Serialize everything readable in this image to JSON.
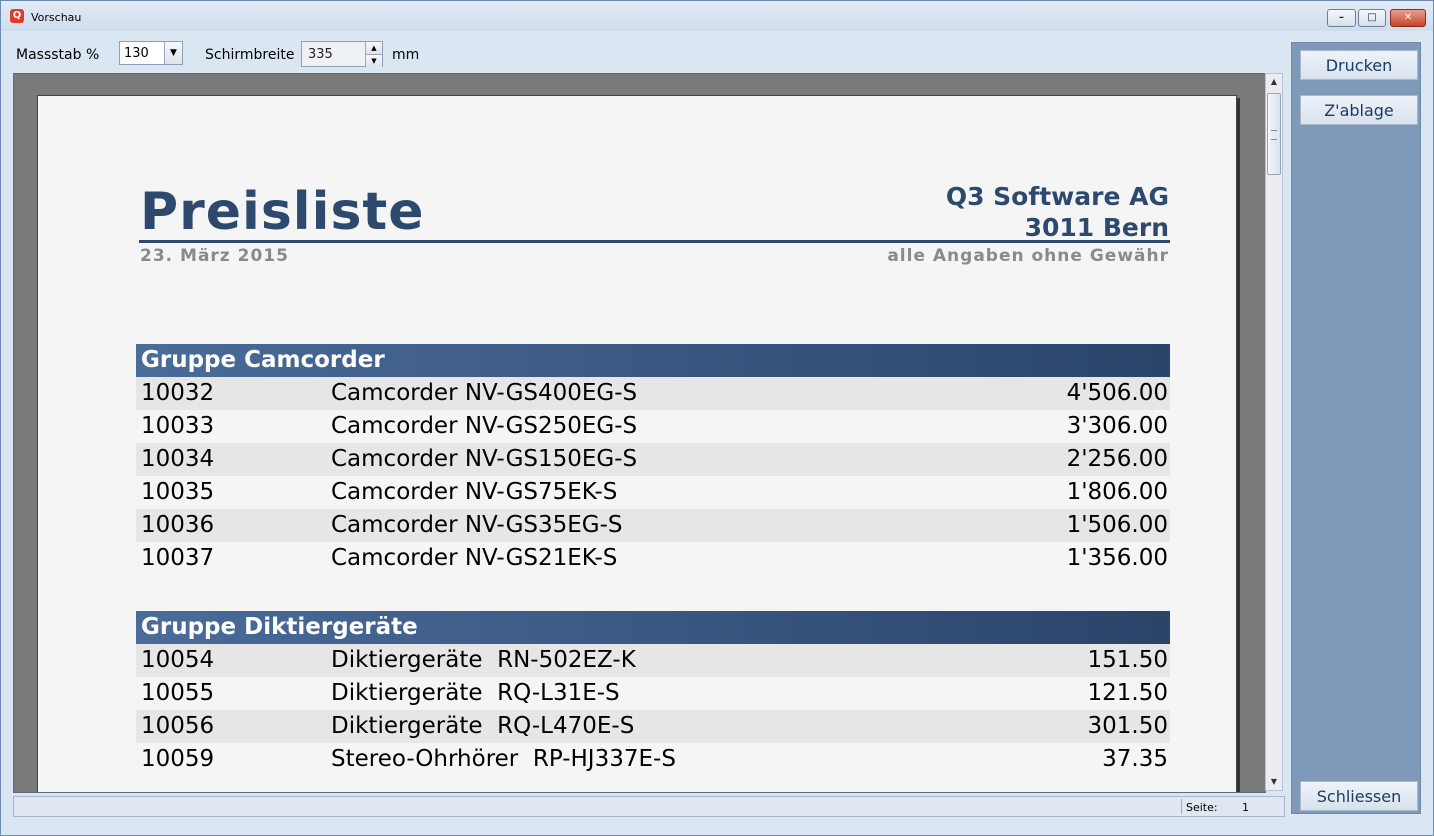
{
  "window": {
    "title": "Vorschau",
    "app_icon": "Q",
    "minimize_glyph": "–",
    "maximize_glyph": "□",
    "close_glyph": "✕"
  },
  "toolbar": {
    "scale_label": "Massstab %",
    "scale_value": "130",
    "width_label": "Schirmbreite",
    "width_value": "335",
    "unit_label": "mm"
  },
  "sidebar": {
    "print_label": "Drucken",
    "clipboard_label": "Z'ablage",
    "close_label": "Schliessen"
  },
  "document": {
    "title": "Preisliste",
    "company": "Q3 Software AG",
    "city": "3011 Bern",
    "date": "23. März 2015",
    "disclaimer": "alle Angaben ohne Gewähr",
    "groups": [
      {
        "name": "Gruppe Camcorder",
        "rows": [
          {
            "id": "10032",
            "desc": "Camcorder NV-GS400EG-S",
            "price": "4'506.00"
          },
          {
            "id": "10033",
            "desc": "Camcorder NV-GS250EG-S",
            "price": "3'306.00"
          },
          {
            "id": "10034",
            "desc": "Camcorder NV-GS150EG-S",
            "price": "2'256.00"
          },
          {
            "id": "10035",
            "desc": "Camcorder NV-GS75EK-S",
            "price": "1'806.00"
          },
          {
            "id": "10036",
            "desc": "Camcorder NV-GS35EG-S",
            "price": "1'506.00"
          },
          {
            "id": "10037",
            "desc": "Camcorder NV-GS21EK-S",
            "price": "1'356.00"
          }
        ]
      },
      {
        "name": "Gruppe Diktiergeräte",
        "rows": [
          {
            "id": "10054",
            "desc": "Diktiergeräte  RN-502EZ-K",
            "price": "151.50"
          },
          {
            "id": "10055",
            "desc": "Diktiergeräte  RQ-L31E-S",
            "price": "121.50"
          },
          {
            "id": "10056",
            "desc": "Diktiergeräte  RQ-L470E-S",
            "price": "301.50"
          },
          {
            "id": "10059",
            "desc": "Stereo-Ohrhörer  RP-HJ337E-S",
            "price": "37.35"
          }
        ]
      }
    ]
  },
  "status": {
    "page_label": "Seite:",
    "page_number": "1"
  },
  "colors": {
    "header_dark": "#2d4a6e",
    "header_light": "#4a6c99",
    "row_shade": "#e6e6e6",
    "panel": "#7f9ab8"
  }
}
